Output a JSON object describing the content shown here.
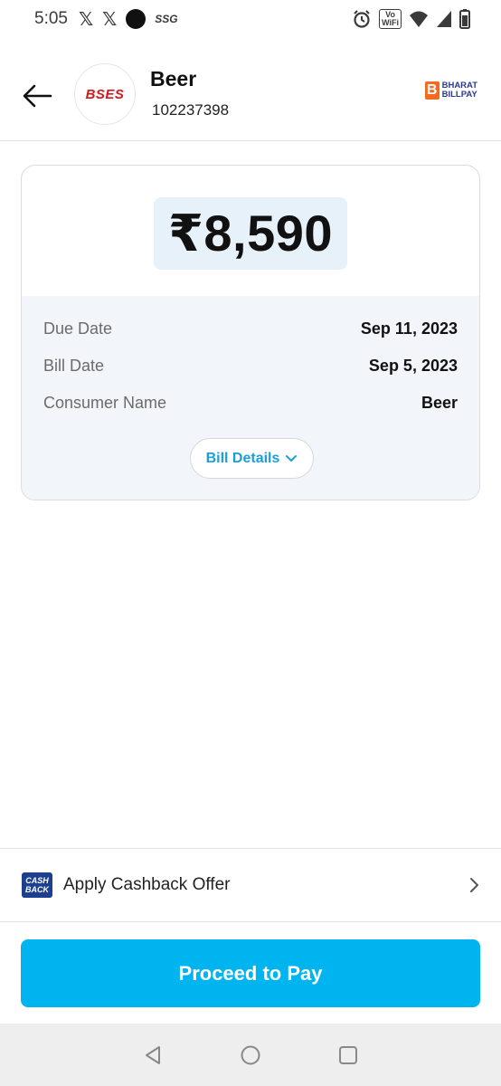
{
  "status_bar": {
    "time": "5:05",
    "notification_icons": [
      "x-icon",
      "x-icon",
      "circle-icon",
      "ssg-icon"
    ],
    "ssg_text": "SSG",
    "wifi_text_top": "Vo",
    "wifi_text_bottom": "WiFi"
  },
  "header": {
    "biller_logo_text": "BSES",
    "biller_name": "Beer",
    "consumer_id": "102237398",
    "bbps_line1": "BHARAT",
    "bbps_line2": "BILLPAY"
  },
  "bill": {
    "amount": "₹8,590",
    "rows": [
      {
        "label": "Due Date",
        "value": "Sep 11, 2023"
      },
      {
        "label": "Bill Date",
        "value": "Sep 5, 2023"
      },
      {
        "label": "Consumer Name",
        "value": "Beer"
      }
    ],
    "details_button_label": "Bill Details"
  },
  "cashback": {
    "icon_line1": "CASH",
    "icon_line2": "BACK",
    "label": "Apply Cashback Offer"
  },
  "proceed_label": "Proceed to Pay",
  "colors": {
    "accent": "#00b4f0",
    "link": "#1aa0d8",
    "amount_bg": "#e6f1f9",
    "details_bg": "#f2f6fb",
    "brand_red": "#d0191f",
    "bbps_orange": "#f26b21",
    "bbps_blue": "#2b3a8c"
  }
}
